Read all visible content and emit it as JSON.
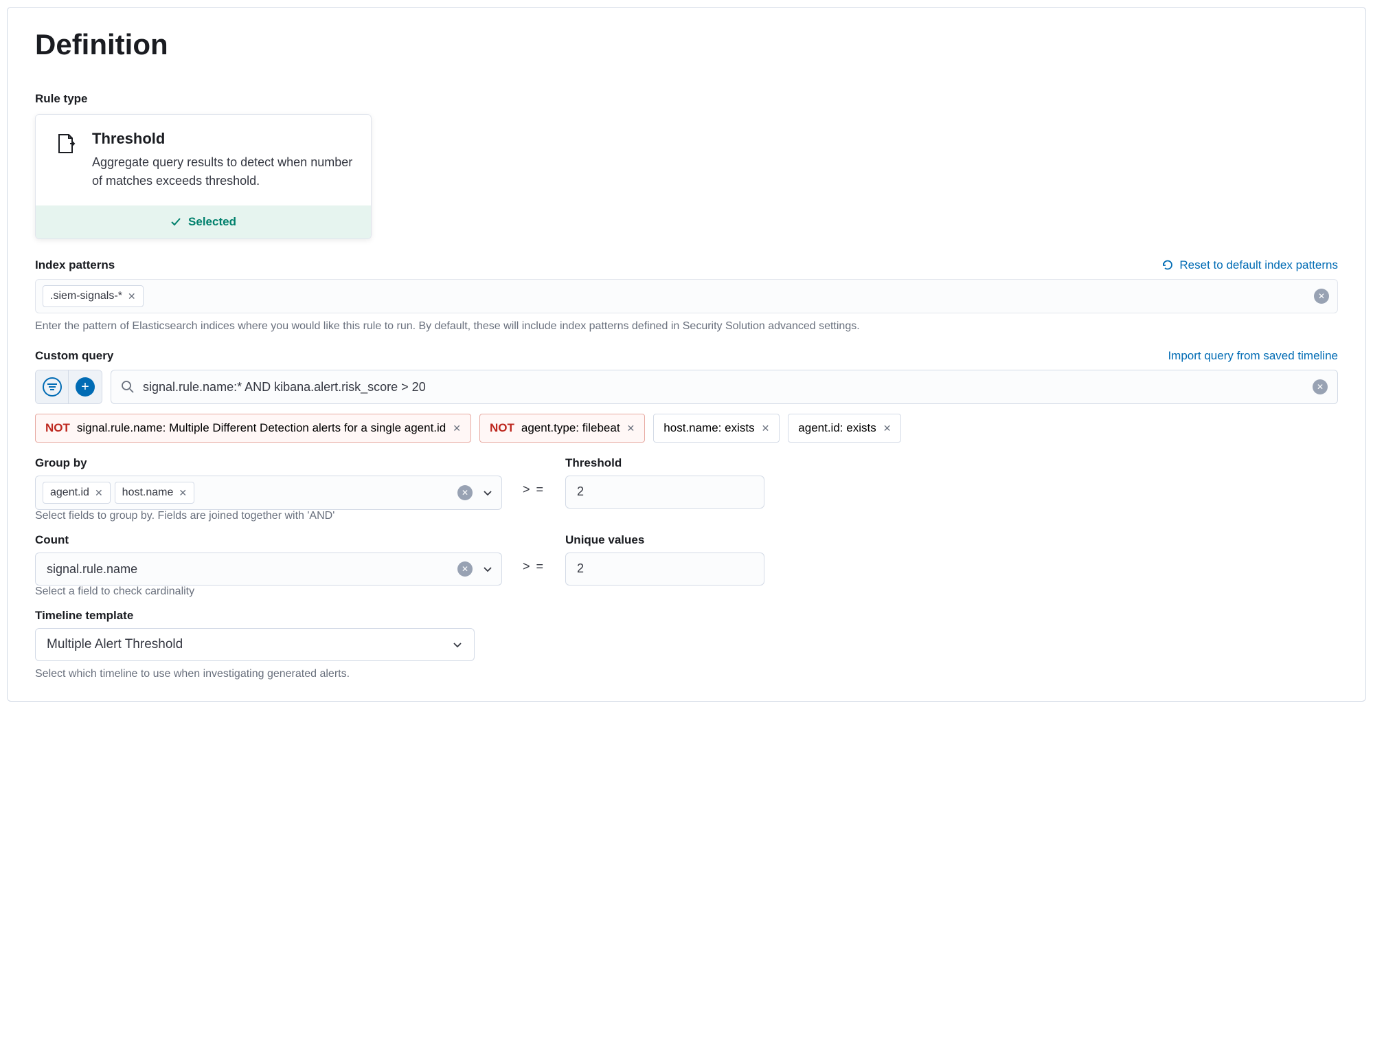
{
  "page": {
    "title": "Definition"
  },
  "ruleType": {
    "label": "Rule type",
    "name": "Threshold",
    "description": "Aggregate query results to detect when number of matches exceeds threshold.",
    "selectedLabel": "Selected"
  },
  "indexPatterns": {
    "label": "Index patterns",
    "resetLink": "Reset to default index patterns",
    "values": [
      ".siem-signals-*"
    ],
    "help": "Enter the pattern of Elasticsearch indices where you would like this rule to run. By default, these will include index patterns defined in Security Solution advanced settings."
  },
  "customQuery": {
    "label": "Custom query",
    "importLink": "Import query from saved timeline",
    "query": "signal.rule.name:* AND kibana.alert.risk_score > 20",
    "filters": [
      {
        "negated": true,
        "text": "signal.rule.name: Multiple Different Detection alerts for a single agent.id"
      },
      {
        "negated": true,
        "text": "agent.type: filebeat"
      },
      {
        "negated": false,
        "text": "host.name: exists"
      },
      {
        "negated": false,
        "text": "agent.id: exists"
      }
    ],
    "notLabel": "NOT"
  },
  "groupBy": {
    "label": "Group by",
    "values": [
      "agent.id",
      "host.name"
    ],
    "help": "Select fields to group by. Fields are joined together with 'AND'"
  },
  "threshold": {
    "label": "Threshold",
    "comparator": "> =",
    "value": "2"
  },
  "count": {
    "label": "Count",
    "value": "signal.rule.name",
    "help": "Select a field to check cardinality"
  },
  "uniqueValues": {
    "label": "Unique values",
    "comparator": "> =",
    "value": "2"
  },
  "timelineTemplate": {
    "label": "Timeline template",
    "value": "Multiple Alert Threshold",
    "help": "Select which timeline to use when investigating generated alerts."
  }
}
